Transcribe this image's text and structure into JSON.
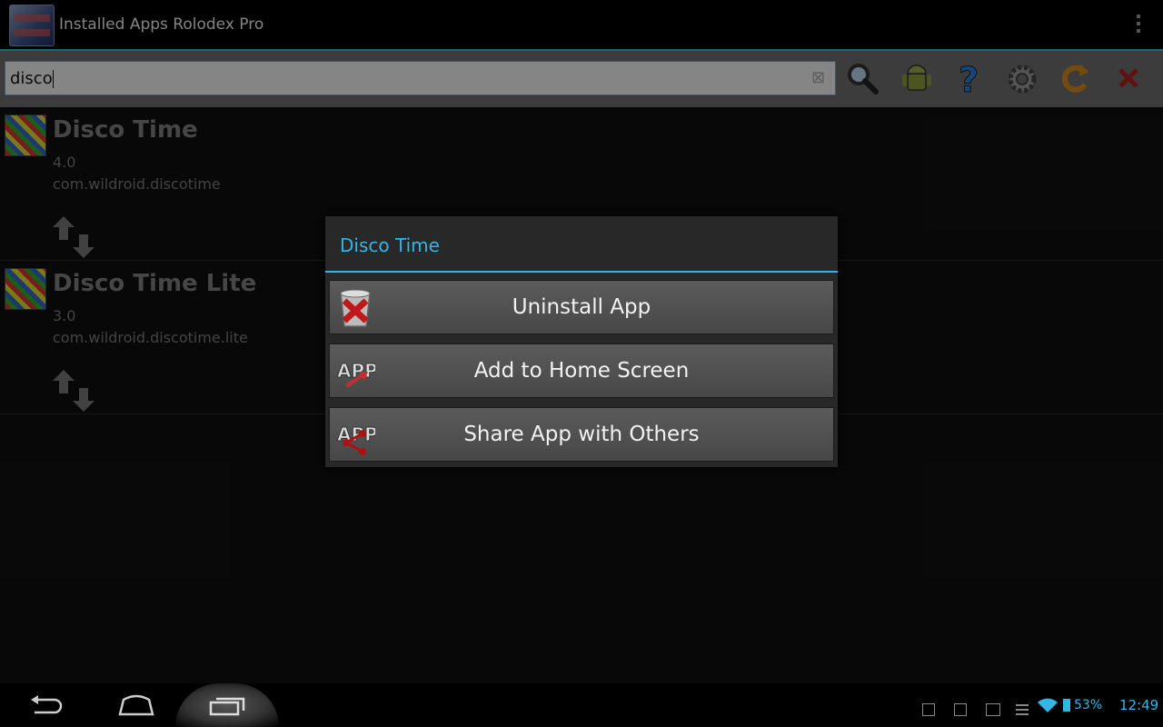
{
  "app": {
    "title": "Installed Apps Rolodex Pro"
  },
  "search": {
    "value": "disco"
  },
  "apps": [
    {
      "name": "Disco Time",
      "version": "4.0",
      "package": "com.wildroid.discotime"
    },
    {
      "name": "Disco Time Lite",
      "version": "3.0",
      "package": "com.wildroid.discotime.lite"
    }
  ],
  "dialog": {
    "title": "Disco Time",
    "buttons": [
      {
        "label": "Uninstall App"
      },
      {
        "label": "Add to Home Screen"
      },
      {
        "label": "Share App with Others"
      }
    ]
  },
  "status": {
    "battery": "53%",
    "time": "12:49"
  },
  "colors": {
    "accent": "#33b5e5"
  }
}
